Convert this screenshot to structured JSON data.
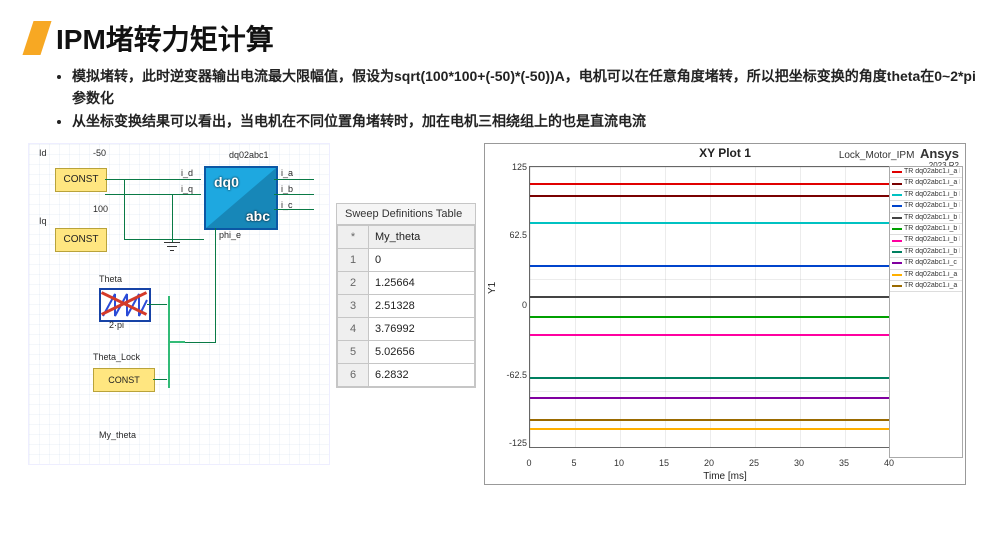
{
  "title": "IPM堵转力矩计算",
  "bullets": [
    "模拟堵转，此时逆变器输出电流最大限幅值，假设为sqrt(100*100+(-50)*(-50))A，电机可以在任意角度堵转，所以把坐标变换的角度theta在0~2*pi参数化",
    "从坐标变换结果可以看出，当电机在不同位置角堵转时，加在电机三相绕组上的也是直流电流"
  ],
  "diagram": {
    "id_label": "Id",
    "id_value": "-50",
    "iq_label": "Iq",
    "iq_value": "100",
    "theta_label": "Theta",
    "block_name": "dq02abc1",
    "block_in": [
      "i_d",
      "i_q"
    ],
    "block_out": [
      "i_a",
      "i_b",
      "i_c"
    ],
    "block_phi": "phi_e",
    "dq0": "dq0",
    "abc": "abc",
    "theta_lock": "Theta_Lock",
    "const": "CONST",
    "my_theta": "My_theta",
    "two_pi": "2·pi"
  },
  "sweep": {
    "header": "Sweep Definitions   Table",
    "column": "My_theta",
    "rows": [
      {
        "i": "1",
        "v": "0"
      },
      {
        "i": "2",
        "v": "1.25664"
      },
      {
        "i": "3",
        "v": "2.51328"
      },
      {
        "i": "4",
        "v": "3.76992"
      },
      {
        "i": "5",
        "v": "5.02656"
      },
      {
        "i": "6",
        "v": "6.2832"
      }
    ]
  },
  "chart_data": {
    "type": "line",
    "title": "XY Plot 1",
    "top_right": "Lock_Motor_IPM",
    "brand": "Ansys",
    "brand_sub": "2023 R2",
    "xlabel": "Time [ms]",
    "ylabel": "Y1",
    "xlim": [
      0,
      40
    ],
    "ylim": [
      -125,
      125
    ],
    "xticks": [
      0,
      5,
      10,
      15,
      20,
      25,
      30,
      35,
      40
    ],
    "yticks": [
      -125,
      -62.5,
      0,
      62.5,
      125
    ],
    "series": [
      {
        "name": "dq02abc1.i_a",
        "theta": "5.02656",
        "value": 111,
        "color": "#e00000"
      },
      {
        "name": "dq02abc1.i_a",
        "theta": "6.2832",
        "value": 100,
        "color": "#7a0000"
      },
      {
        "name": "dq02abc1.i_b",
        "theta": "0",
        "value": 76,
        "color": "#00c2c2"
      },
      {
        "name": "dq02abc1.i_b",
        "theta": "1.25664",
        "value": 38,
        "color": "#0044cc"
      },
      {
        "name": "dq02abc1.i_b",
        "theta": "2.51328",
        "value": 10,
        "color": "#444444"
      },
      {
        "name": "dq02abc1.i_b",
        "theta": "3.76992",
        "value": -8,
        "color": "#00a000"
      },
      {
        "name": "dq02abc1.i_b",
        "theta": "5.02656",
        "value": -24,
        "color": "#ff00a0"
      },
      {
        "name": "dq02abc1.i_b",
        "theta": "6.2832",
        "value": -62,
        "color": "#008060"
      },
      {
        "name": "dq02abc1.i_c",
        "theta": "",
        "value": -80,
        "color": "#8000a0"
      },
      {
        "name": "dq02abc1.i_a",
        "theta": "",
        "value": -108,
        "color": "#ffb000"
      },
      {
        "name": "dq02abc1.i_a",
        "theta": "",
        "value": -100,
        "color": "#9a6a00"
      }
    ]
  }
}
